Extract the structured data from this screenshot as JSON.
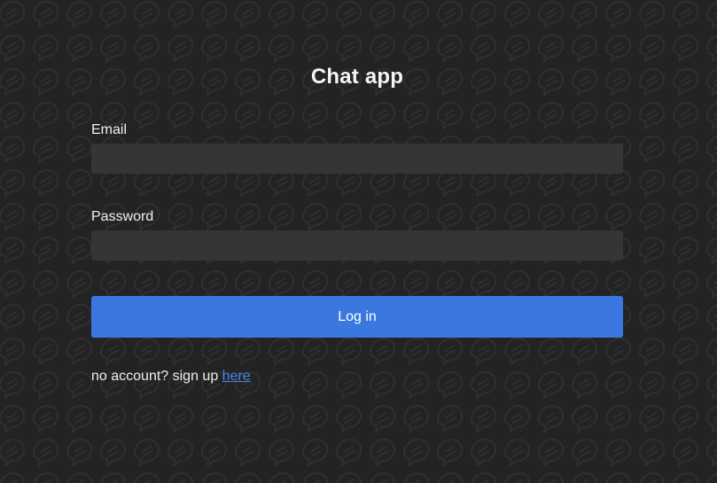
{
  "app": {
    "title": "Chat app"
  },
  "form": {
    "email_label": "Email",
    "email_value": "",
    "password_label": "Password",
    "password_value": "",
    "login_button_label": "Log in"
  },
  "signup": {
    "prompt_text": "no account? sign up ",
    "link_text": "here"
  },
  "colors": {
    "background": "#232323",
    "input_background": "#353535",
    "accent": "#3a78e0",
    "link": "#4a86e8",
    "pattern_stroke": "#2e2e2e"
  },
  "icons": {
    "background_pattern": "chat-bubble-icon"
  }
}
